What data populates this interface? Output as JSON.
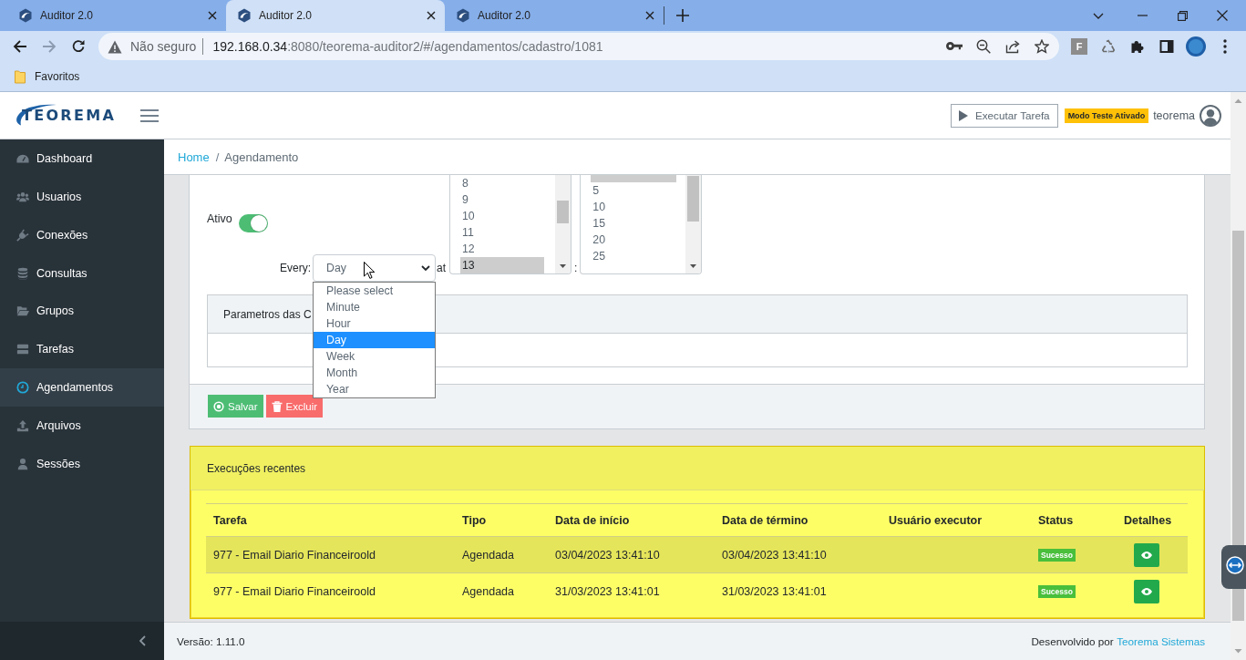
{
  "browser": {
    "tabs": [
      {
        "title": "Auditor 2.0",
        "selected": false
      },
      {
        "title": "Auditor 2.0",
        "selected": true
      },
      {
        "title": "Auditor 2.0",
        "selected": false
      }
    ],
    "forward_disabled": true,
    "address": {
      "security": "Não seguro",
      "host": "192.168.0.34",
      "path": ":8080/teorema-auditor2/#/agendamentos/cadastro/1081"
    },
    "extension_letter": "F",
    "bookmarks": [
      {
        "label": "Favoritos"
      }
    ]
  },
  "header": {
    "logo": "TEOREMA",
    "run_button": "Executar Tarefa",
    "test_badge": "Modo Teste Ativado",
    "user": "teorema"
  },
  "sidebar": {
    "items": [
      {
        "label": "Dashboard",
        "selected": false
      },
      {
        "label": "Usuarios",
        "selected": false
      },
      {
        "label": "Conexões",
        "selected": false
      },
      {
        "label": "Consultas",
        "selected": false
      },
      {
        "label": "Grupos",
        "selected": false
      },
      {
        "label": "Tarefas",
        "selected": false
      },
      {
        "label": "Agendamentos",
        "selected": true
      },
      {
        "label": "Arquivos",
        "selected": false
      },
      {
        "label": "Sessões",
        "selected": false
      }
    ]
  },
  "breadcrumb": {
    "items": [
      {
        "label": "Home",
        "link": true
      },
      {
        "label": "Agendamento",
        "link": false
      }
    ],
    "separator": "/"
  },
  "schedule": {
    "active": {
      "label": "Ativo",
      "on": true
    },
    "every": {
      "label": "Every:",
      "value": "Day",
      "expanded": true,
      "options": [
        {
          "label": "Please select",
          "selected": false
        },
        {
          "label": "Minute",
          "selected": false
        },
        {
          "label": "Hour",
          "selected": false
        },
        {
          "label": "Day",
          "selected": true
        },
        {
          "label": "Week",
          "selected": false
        },
        {
          "label": "Month",
          "selected": false
        },
        {
          "label": "Year",
          "selected": false
        }
      ]
    },
    "at_label": "at",
    "hours": {
      "options": [
        {
          "label": "8",
          "selected": false
        },
        {
          "label": "9",
          "selected": false
        },
        {
          "label": "10",
          "selected": false
        },
        {
          "label": "11",
          "selected": false
        },
        {
          "label": "12",
          "selected": false
        },
        {
          "label": "13",
          "selected": true
        }
      ]
    },
    "time_separator": ":",
    "minutes": {
      "top_row_selected": true,
      "options": [
        {
          "label": "5",
          "selected": false
        },
        {
          "label": "10",
          "selected": false
        },
        {
          "label": "15",
          "selected": false
        },
        {
          "label": "20",
          "selected": false
        },
        {
          "label": "25",
          "selected": false
        }
      ]
    },
    "params_panel": {
      "title": "Parametros das C"
    },
    "actions": [
      {
        "label": "Salvar",
        "kind": "save"
      },
      {
        "label": "Excluir",
        "kind": "delete"
      }
    ]
  },
  "recent_executions": {
    "title": "Execuções recentes",
    "highlighted": true,
    "columns": [
      "Tarefa",
      "Tipo",
      "Data de início",
      "Data de término",
      "Usuário executor",
      "Status",
      "Detalhes"
    ],
    "rows": [
      {
        "task": "977 - Email Diario Financeiroold",
        "type": "Agendada",
        "start": "03/04/2023 13:41:10",
        "end": "03/04/2023 13:41:10",
        "status": "Sucesso"
      },
      {
        "task": "977 - Email Diario Financeiroold",
        "type": "Agendada",
        "start": "31/03/2023 13:41:01",
        "end": "31/03/2023 13:41:01",
        "status": "Sucesso"
      }
    ]
  },
  "footer": {
    "version": "Versão: 1.11.0",
    "credit": "Desenvolvido por",
    "credit_link": "Teorema Sistemas"
  }
}
